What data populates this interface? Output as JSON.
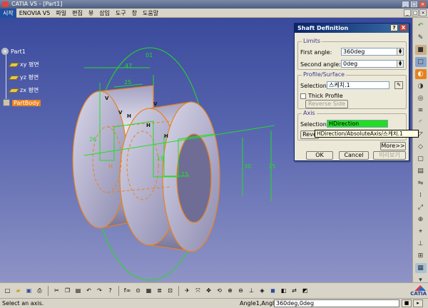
{
  "window": {
    "title": "CATIA V5 - [Part1]"
  },
  "menu": [
    {
      "label": "시작",
      "active": true
    },
    {
      "label": "ENOVIA V5"
    },
    {
      "label": "파일"
    },
    {
      "label": "편집"
    },
    {
      "label": "뷰"
    },
    {
      "label": "삽입"
    },
    {
      "label": "도구"
    },
    {
      "label": "창"
    },
    {
      "label": "도움말"
    }
  ],
  "tree": {
    "root": "Part1",
    "planes": [
      "xy 평면",
      "yz 평면",
      "zx 평면"
    ],
    "body": "PartBody"
  },
  "dimensions": {
    "d47": "47",
    "d25": "25",
    "d26": "26",
    "d19": "19",
    "d15": "15",
    "d30": "30",
    "d35": "35",
    "d01": "01",
    "h": "H",
    "v": "V"
  },
  "dialog": {
    "title": "Shaft Definition",
    "help_btn": "?",
    "close_btn": "X",
    "limits": {
      "title": "Limits",
      "first_label": "First angle:",
      "first_value": "360deg",
      "second_label": "Second angle:",
      "second_value": "0deg"
    },
    "profile": {
      "title": "Profile/Surface",
      "selection_label": "Selection:",
      "selection_value": "스케치.1",
      "thick_label": "Thick Profile",
      "reverse_side": "Reverse Side"
    },
    "axis": {
      "title": "Axis",
      "selection_label": "Selection:",
      "selection_value": "HDirection",
      "reverse_label": "Reve"
    },
    "more_btn": "More>>",
    "ok_btn": "OK",
    "cancel_btn": "Cancel",
    "preview_btn": "미리보기"
  },
  "tooltip": "HDirection/AbsoluteAxis/스케치.1",
  "status": {
    "message": "Select an axis.",
    "prompt_label": "Angle1,Angle2",
    "prompt_value": "360deg,0deg"
  },
  "logo": "CATIA",
  "colors": {
    "viewport_top": "#3a4a9c",
    "sketch_green": "#22dd22",
    "highlight_orange": "#e8821e",
    "dialog_title": "#0a246a"
  }
}
